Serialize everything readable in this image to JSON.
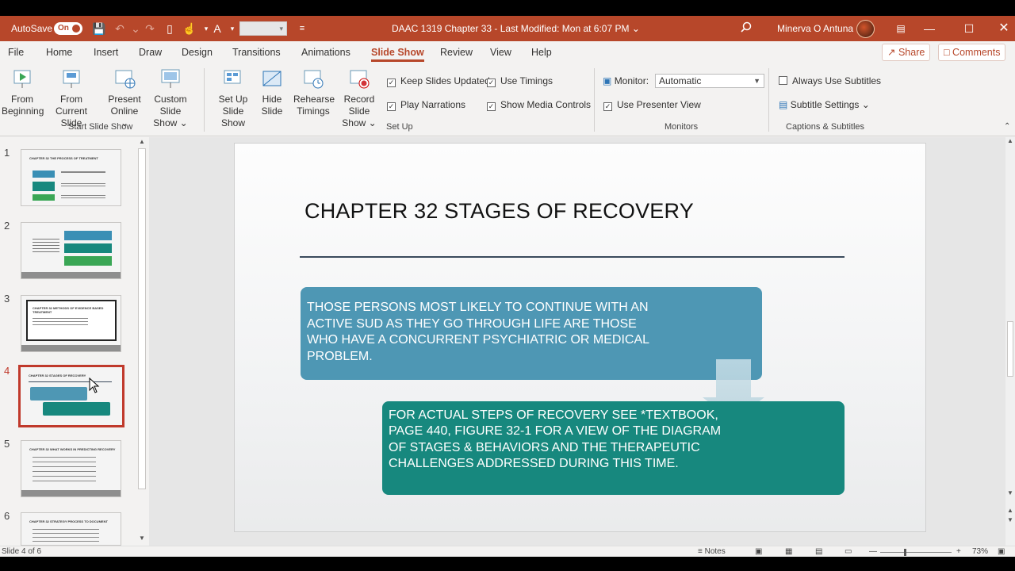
{
  "titlebar": {
    "autosave_label": "AutoSave",
    "autosave_state": "On",
    "doc_title": "DAAC 1319 Chapter 33  -  Last Modified: Mon at 6:07 PM  ⌄",
    "user_name": "Minerva O Antuna"
  },
  "tabs": [
    "File",
    "Home",
    "Insert",
    "Draw",
    "Design",
    "Transitions",
    "Animations",
    "Slide Show",
    "Review",
    "View",
    "Help"
  ],
  "active_tab": "Slide Show",
  "share_label": "Share",
  "comments_label": "Comments",
  "ribbon": {
    "from_beginning_1": "From",
    "from_beginning_2": "Beginning",
    "from_current_1": "From",
    "from_current_2": "Current Slide",
    "present_online_1": "Present",
    "present_online_2": "Online ⌄",
    "custom_show_1": "Custom Slide",
    "custom_show_2": "Show ⌄",
    "group_start": "Start Slide Show",
    "setup_show_1": "Set Up",
    "setup_show_2": "Slide Show",
    "hide_slide_1": "Hide",
    "hide_slide_2": "Slide",
    "rehearse_1": "Rehearse",
    "rehearse_2": "Timings",
    "record_1": "Record Slide",
    "record_2": "Show ⌄",
    "keep_slides_updated": "Keep Slides Updated",
    "use_timings": "Use Timings",
    "play_narrations": "Play Narrations",
    "show_media_controls": "Show Media Controls",
    "group_setup": "Set Up",
    "monitor_label": "Monitor:",
    "monitor_value": "Automatic",
    "use_presenter_view": "Use Presenter View",
    "group_monitors": "Monitors",
    "always_use_subtitles": "Always Use Subtitles",
    "subtitle_settings": "Subtitle Settings ⌄",
    "group_captions": "Captions & Subtitles"
  },
  "thumbnails": [
    {
      "num": "1",
      "title": "CHAPTER 32    THE PROCESS OF TREATMENT"
    },
    {
      "num": "2",
      "title": "CHAPTER 32 THE TREATMENT PROCESS"
    },
    {
      "num": "3",
      "title": "CHAPTER 32  METHODS OF EVIDENCE BASED TREATMENT"
    },
    {
      "num": "4",
      "title": "CHAPTER 32  STAGES OF RECOVERY"
    },
    {
      "num": "5",
      "title": "CHAPTER 32  WHAT WORKS IN PREDICTING RECOVERY"
    },
    {
      "num": "6",
      "title": "CHAPTER 32  STRATEGY PROCESS TO DOCUMENT"
    }
  ],
  "slide": {
    "title": "CHAPTER 32  STAGES OF RECOVERY",
    "box1_text": "THOSE PERSONS MOST LIKELY TO CONTINUE WITH AN ACTIVE SUD AS THEY GO THROUGH LIFE ARE THOSE WHO HAVE A CONCURRENT PSYCHIATRIC OR MEDICAL PROBLEM.",
    "box2_text": "FOR ACTUAL STEPS OF RECOVERY  SEE *TEXTBOOK, PAGE 440,         FIGURE 32-1 FOR A VIEW OF THE DIAGRAM OF STAGES & BEHAVIORS AND THE THERAPEUTIC CHALLENGES ADDRESSED DURING THIS TIME.",
    "box1_color": "#4e97b4",
    "box2_color": "#17887e"
  },
  "status": {
    "slide_count": "Slide 4 of 6",
    "notes_label": "Notes",
    "zoom": "73%"
  },
  "colors": {
    "accent": "#b7472a"
  }
}
